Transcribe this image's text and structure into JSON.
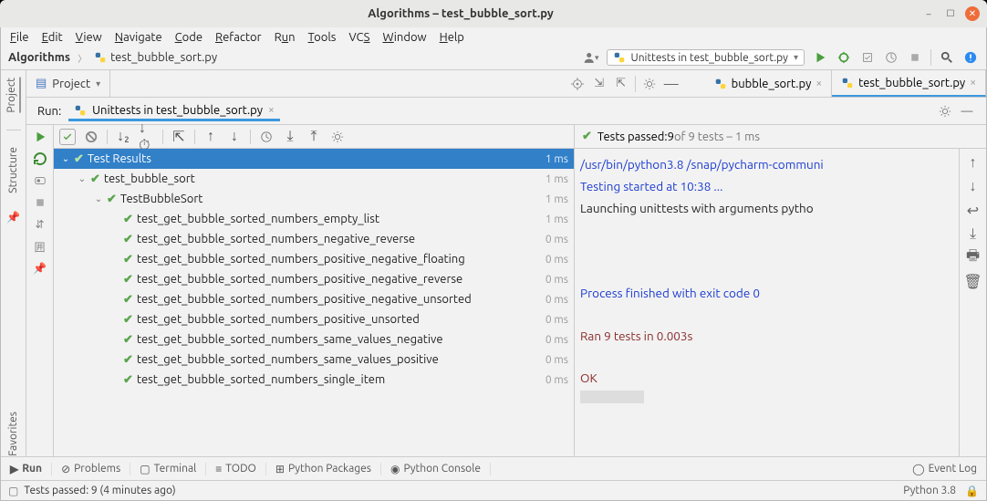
{
  "window": {
    "title": "Algorithms – test_bubble_sort.py"
  },
  "menu": [
    "File",
    "Edit",
    "View",
    "Navigate",
    "Code",
    "Refactor",
    "Run",
    "Tools",
    "VCS",
    "Window",
    "Help"
  ],
  "breadcrumbs": {
    "project": "Algorithms",
    "file": "test_bubble_sort.py"
  },
  "run_config": {
    "label": "Unittests in test_bubble_sort.py"
  },
  "project_tab": {
    "label": "Project"
  },
  "sidebars": {
    "project": "Project",
    "structure": "Structure",
    "favorites": "Favorites"
  },
  "editor_tabs": [
    {
      "label": "bubble_sort.py",
      "active": false
    },
    {
      "label": "test_bubble_sort.py",
      "active": true
    }
  ],
  "run_panel": {
    "label": "Run:",
    "session": "Unittests in test_bubble_sort.py"
  },
  "tests_header": {
    "prefix": "Tests passed: ",
    "passed": "9",
    "suffix": " of 9 tests – 1 ms"
  },
  "tree": [
    {
      "indent": 0,
      "expander": true,
      "pass": true,
      "label": "Test Results",
      "time": "1 ms",
      "header": true
    },
    {
      "indent": 1,
      "expander": true,
      "pass": true,
      "label": "test_bubble_sort",
      "time": "1 ms"
    },
    {
      "indent": 2,
      "expander": true,
      "pass": true,
      "label": "TestBubbleSort",
      "time": "1 ms"
    },
    {
      "indent": 3,
      "expander": false,
      "pass": true,
      "label": "test_get_bubble_sorted_numbers_empty_list",
      "time": "1 ms"
    },
    {
      "indent": 3,
      "expander": false,
      "pass": true,
      "label": "test_get_bubble_sorted_numbers_negative_reverse",
      "time": "0 ms"
    },
    {
      "indent": 3,
      "expander": false,
      "pass": true,
      "label": "test_get_bubble_sorted_numbers_positive_negative_floating",
      "time": "0 ms"
    },
    {
      "indent": 3,
      "expander": false,
      "pass": true,
      "label": "test_get_bubble_sorted_numbers_positive_negative_reverse",
      "time": "0 ms"
    },
    {
      "indent": 3,
      "expander": false,
      "pass": true,
      "label": "test_get_bubble_sorted_numbers_positive_negative_unsorted",
      "time": "0 ms"
    },
    {
      "indent": 3,
      "expander": false,
      "pass": true,
      "label": "test_get_bubble_sorted_numbers_positive_unsorted",
      "time": "0 ms"
    },
    {
      "indent": 3,
      "expander": false,
      "pass": true,
      "label": "test_get_bubble_sorted_numbers_same_values_negative",
      "time": "0 ms"
    },
    {
      "indent": 3,
      "expander": false,
      "pass": true,
      "label": "test_get_bubble_sorted_numbers_same_values_positive",
      "time": "0 ms"
    },
    {
      "indent": 3,
      "expander": false,
      "pass": true,
      "label": "test_get_bubble_sorted_numbers_single_item",
      "time": "0 ms"
    }
  ],
  "console": {
    "line1": "/usr/bin/python3.8 /snap/pycharm-communi",
    "line2": "Testing started at 10:38 ...",
    "line3": "Launching unittests with arguments pytho",
    "proc": "Process finished with exit code 0",
    "ran": "Ran 9 tests in 0.003s",
    "ok": "OK"
  },
  "bottom": {
    "run": "Run",
    "problems": "Problems",
    "terminal": "Terminal",
    "todo": "TODO",
    "pkg": "Python Packages",
    "pyconsole": "Python Console",
    "eventlog": "Event Log"
  },
  "status": {
    "text": "Tests passed: 9 (4 minutes ago)",
    "python": "Python 3.8"
  }
}
